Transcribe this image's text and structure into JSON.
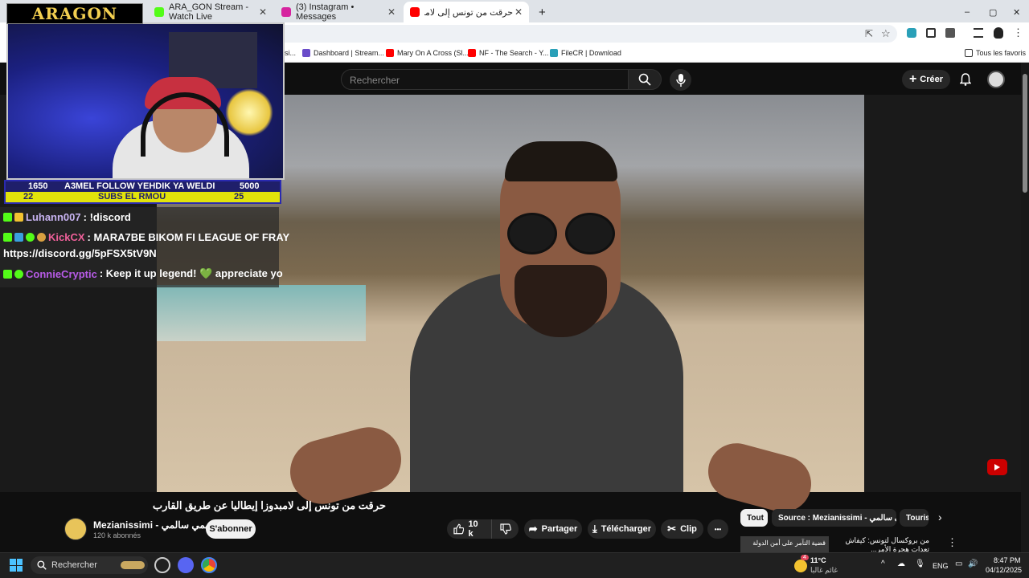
{
  "browser": {
    "tabs": [
      {
        "title": "ARA_GON Stream - Watch Live",
        "color": "#53fc18"
      },
      {
        "title": "(3) Instagram • Messages",
        "color": "#d6249f"
      },
      {
        "title": "حرقت من تونس إلى لامبدوزا إيطا...",
        "color": "#ff0000"
      }
    ],
    "new_tab_label": "+",
    "window_controls": [
      "–",
      "▢",
      "✕"
    ],
    "bookmarks": [
      {
        "label": "si...",
        "color": "#888888"
      },
      {
        "label": "Dashboard | Stream...",
        "color": "#6a4cc9"
      },
      {
        "label": "Mary On A Cross (Sl...",
        "color": "#ff0000"
      },
      {
        "label": "NF - The Search - Y...",
        "color": "#ff0000"
      },
      {
        "label": "FileCR | Download",
        "color": "#2aa0b8"
      }
    ],
    "all_bookmarks_label": "Tous les favoris"
  },
  "youtube": {
    "search_placeholder": "Rechercher",
    "create_label": "Créer",
    "video": {
      "title": "حرقت من تونس إلى لامبدوزا إيطاليا عن طريق القارب",
      "channel_name": "Mezianissimi - فهمي سالمي",
      "subscribers": "120 k abonnés",
      "subscribe_label": "S'abonner",
      "likes": "10 k",
      "share_label": "Partager",
      "download_label": "Télécharger",
      "clip_label": "Clip",
      "more_label": "•••"
    },
    "chips": [
      {
        "label": "Tout",
        "active": true
      },
      {
        "label": "Source : Mezianissimi - فهمي سالمي",
        "active": false
      },
      {
        "label": "Touris",
        "active": false
      }
    ],
    "recommendation": {
      "thumb_text": "قضية التآمر على أمن الدولة",
      "title": "من بروكسال لتونس: كيفاش تعدات هجرة الأمر..."
    }
  },
  "stream_overlay": {
    "logo": "ARAGON",
    "goal_left_top": "1650",
    "goal_text_top": "A3MEL FOLLOW YEHDIK YA WELDI",
    "goal_right_top": "5000",
    "goal_left_bottom": "22",
    "goal_text_bottom": "SUBS EL RMOU",
    "goal_right_bottom": "25",
    "chat": [
      {
        "user": "Luhann007",
        "user_color": "#c7b3f0",
        "message": ": !discord"
      },
      {
        "user": "KickCX",
        "user_color": "#f0609a",
        "message": ": MARA7BE BIKOM FI LEAGUE OF FRAY"
      },
      {
        "user": "",
        "user_color": "#ffffff",
        "message": "https://discord.gg/5pFSX5tV9N"
      },
      {
        "user": "ConnieCryptic",
        "user_color": "#b85be8",
        "message": ": Keep it up legend!  💚  appreciate yo"
      }
    ]
  },
  "taskbar": {
    "search_label": "Rechercher",
    "weather_temp": "11°C",
    "weather_desc": "غائم غالبا",
    "weather_badge": "4",
    "language": "ENG",
    "time": "8:47 PM",
    "date": "04/12/2025"
  },
  "colors": {
    "youtube_bg": "#0f0f0f",
    "kick_green": "#53fc18",
    "goal_yellow": "#e2e30b"
  }
}
